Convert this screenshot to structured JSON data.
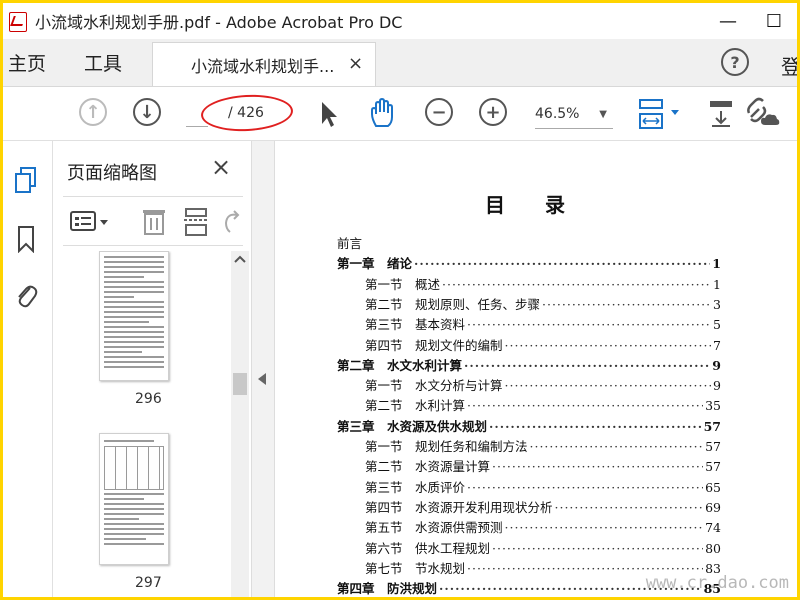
{
  "window": {
    "title": "小流域水利规划手册.pdf - Adobe Acrobat Pro DC",
    "minimize": "—",
    "maximize": "☐"
  },
  "tabs": {
    "home": "主页",
    "tools": "工具",
    "document": "小流域水利规划手...",
    "document_close": "×",
    "login": "登"
  },
  "toolbar": {
    "page_current": "",
    "page_total": "/ 426",
    "zoom": "46.5%"
  },
  "panel": {
    "title": "页面缩略图",
    "close": "×",
    "thumbnails": [
      {
        "page": "296"
      },
      {
        "page": "297"
      }
    ]
  },
  "document": {
    "heading": "目　　录",
    "toc": [
      {
        "level": "plain",
        "label": "前言",
        "page": ""
      },
      {
        "level": "chapter",
        "label": "第一章　绪论",
        "page": "1"
      },
      {
        "level": "section",
        "label": "第一节　概述",
        "page": "1"
      },
      {
        "level": "section",
        "label": "第二节　规划原则、任务、步骤",
        "page": "3"
      },
      {
        "level": "section",
        "label": "第三节　基本资料",
        "page": "5"
      },
      {
        "level": "section",
        "label": "第四节　规划文件的编制",
        "page": "7"
      },
      {
        "level": "chapter",
        "label": "第二章　水文水利计算",
        "page": "9"
      },
      {
        "level": "section",
        "label": "第一节　水文分析与计算",
        "page": "9"
      },
      {
        "level": "section",
        "label": "第二节　水利计算",
        "page": "35"
      },
      {
        "level": "chapter",
        "label": "第三章　水资源及供水规划",
        "page": "57"
      },
      {
        "level": "section",
        "label": "第一节　规划任务和编制方法",
        "page": "57"
      },
      {
        "level": "section",
        "label": "第二节　水资源量计算",
        "page": "57"
      },
      {
        "level": "section",
        "label": "第三节　水质评价",
        "page": "65"
      },
      {
        "level": "section",
        "label": "第四节　水资源开发利用现状分析",
        "page": "69"
      },
      {
        "level": "section",
        "label": "第五节　水资源供需预测",
        "page": "74"
      },
      {
        "level": "section",
        "label": "第六节　供水工程规划",
        "page": "80"
      },
      {
        "level": "section",
        "label": "第七节　节水规划",
        "page": "83"
      },
      {
        "level": "chapter",
        "label": "第四章　防洪规划",
        "page": "85"
      }
    ],
    "watermark": "www.cr.dao.com"
  },
  "colors": {
    "frame_border": "#ffd400",
    "annotation": "#e02020",
    "accent": "#1a73c8"
  }
}
